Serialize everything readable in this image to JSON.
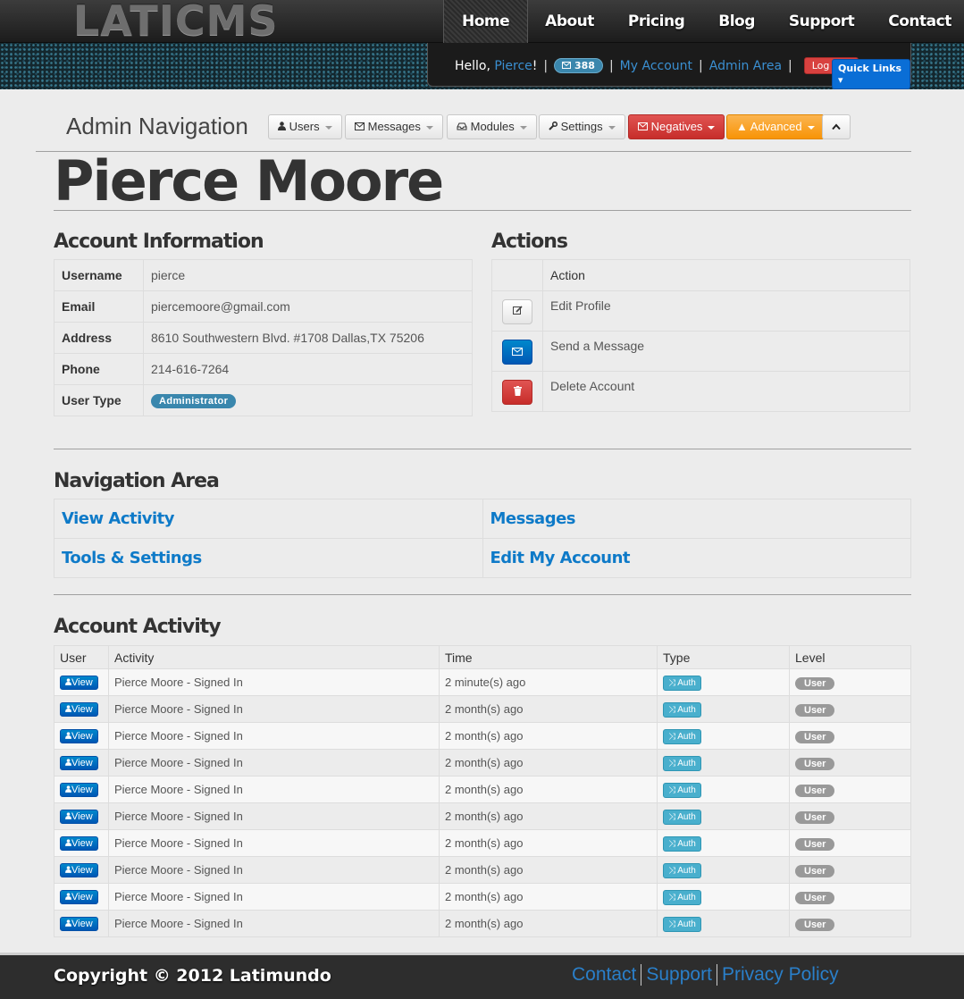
{
  "header": {
    "logo": "LATICMS",
    "nav": [
      "Home",
      "About",
      "Pricing",
      "Blog",
      "Support",
      "Contact"
    ],
    "active": "Home",
    "hello": "Hello,",
    "username": "Pierce",
    "bang": "!",
    "message_count": "388",
    "my_account": "My Account",
    "admin_area": "Admin Area",
    "logout": "Log Out",
    "quick_links": "Quick Links"
  },
  "admin_nav": {
    "title": "Admin Navigation",
    "buttons": {
      "users": "Users",
      "messages": "Messages",
      "modules": "Modules",
      "settings": "Settings",
      "negatives": "Negatives",
      "advanced": "Advanced"
    }
  },
  "page_title": "Pierce Moore",
  "account_info": {
    "title": "Account Information",
    "rows": [
      {
        "label": "Username",
        "value": "pierce"
      },
      {
        "label": "Email",
        "value": "piercemoore@gmail.com"
      },
      {
        "label": "Address",
        "value": "8610 Southwestern Blvd. #1708 Dallas,TX 75206"
      },
      {
        "label": "Phone",
        "value": "214-616-7264"
      },
      {
        "label": "User Type",
        "value": "Administrator"
      }
    ]
  },
  "actions": {
    "title": "Actions",
    "header": "Action",
    "items": [
      {
        "label": "Edit Profile",
        "icon": "edit-icon"
      },
      {
        "label": "Send a Message",
        "icon": "envelope-icon"
      },
      {
        "label": "Delete Account",
        "icon": "trash-icon"
      }
    ]
  },
  "navigation_area": {
    "title": "Navigation Area",
    "links": [
      "View Activity",
      "Messages",
      "Tools & Settings",
      "Edit My Account"
    ]
  },
  "activity": {
    "title": "Account Activity",
    "columns": [
      "User",
      "Activity",
      "Time",
      "Type",
      "Level"
    ],
    "view_label": "View",
    "type_label": "Auth",
    "level_label": "User",
    "rows": [
      {
        "activity": "Pierce Moore - Signed In",
        "time": "2 minute(s) ago"
      },
      {
        "activity": "Pierce Moore - Signed In",
        "time": "2 month(s) ago"
      },
      {
        "activity": "Pierce Moore - Signed In",
        "time": "2 month(s) ago"
      },
      {
        "activity": "Pierce Moore - Signed In",
        "time": "2 month(s) ago"
      },
      {
        "activity": "Pierce Moore - Signed In",
        "time": "2 month(s) ago"
      },
      {
        "activity": "Pierce Moore - Signed In",
        "time": "2 month(s) ago"
      },
      {
        "activity": "Pierce Moore - Signed In",
        "time": "2 month(s) ago"
      },
      {
        "activity": "Pierce Moore - Signed In",
        "time": "2 month(s) ago"
      },
      {
        "activity": "Pierce Moore - Signed In",
        "time": "2 month(s) ago"
      },
      {
        "activity": "Pierce Moore - Signed In",
        "time": "2 month(s) ago"
      }
    ]
  },
  "footer": {
    "copyright": "Copyright © 2012 Latimundo",
    "links": [
      "Contact",
      "Support",
      "Privacy Policy"
    ]
  },
  "colors": {
    "accent": "#0e7ac8",
    "danger": "#d8413f",
    "warning": "#f89406",
    "info": "#3a87ad"
  }
}
